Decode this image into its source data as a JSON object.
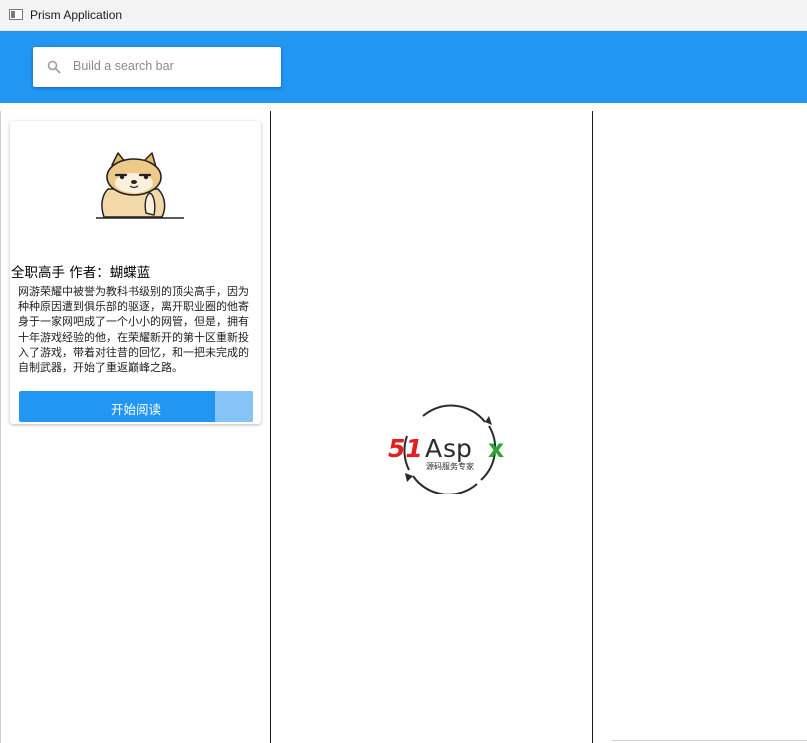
{
  "window": {
    "title": "Prism Application"
  },
  "search": {
    "placeholder": "Build a search bar"
  },
  "book": {
    "title": "全职高手",
    "author_label": "作者：",
    "author": "蝴蝶蓝",
    "description": "网游荣耀中被誉为教科书级别的顶尖高手，因为种种原因遭到俱乐部的驱逐，离开职业圈的他寄身于一家网吧成了一个小小的网管，但是，拥有十年游戏经验的他，在荣耀新开的第十区重新投入了游戏，带着对往昔的回忆，和一把未完成的自制武器，开始了重返巅峰之路。",
    "read_button": "开始阅读"
  },
  "logo": {
    "brand_51": "51",
    "brand_a": "A",
    "brand_sp": "sp",
    "brand_x": "x",
    "tagline": "源码服务专家",
    "colors": {
      "red": "#e02020",
      "dark": "#2b2b2b",
      "green": "#2ea52e"
    }
  },
  "colors": {
    "header": "#2196f3",
    "button": "#2196f3",
    "button_shade": "#86c3f7"
  }
}
